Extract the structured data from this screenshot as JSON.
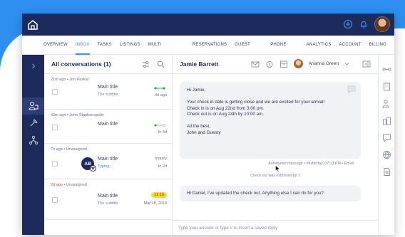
{
  "nav": {
    "items": [
      {
        "label": "OVERVIEW",
        "active": false
      },
      {
        "label": "INBOX",
        "active": true
      },
      {
        "label": "TASKS",
        "active": false
      },
      {
        "label": "LISTINGS",
        "active": false
      },
      {
        "label": "MULTI CALENDAR",
        "active": false
      },
      {
        "label": "RESERVATIONS",
        "active": false
      },
      {
        "label": "GUEST BOOK",
        "active": false
      },
      {
        "label": "PHONE BOOK",
        "active": false
      },
      {
        "label": "ANALYTICS",
        "active": false
      },
      {
        "label": "ACCOUNT",
        "active": false
      },
      {
        "label": "BILLING",
        "active": false
      }
    ]
  },
  "conversations": {
    "title": "All conversations (1)",
    "items": [
      {
        "meta": "21m ago • Jim Paskal",
        "due": "",
        "main": "Main title",
        "sub": "The subtitle",
        "right": "4d ago"
      },
      {
        "meta": "43m ago • John Staphanopolis",
        "due": "",
        "main": "Main title",
        "sub": "",
        "right": "In 4d"
      },
      {
        "meta": "7h ago • Unassigned",
        "due": "",
        "main": "Main title",
        "sub": "Typing...",
        "right_top": "Inquiry",
        "right": "In 2d",
        "avatar": "AB"
      },
      {
        "meta_due": "2d ago",
        "meta": " • Unassigned",
        "main": "Main title",
        "sub": "The subtitle",
        "badge": "12:15",
        "right": "Mar 18, 2018"
      }
    ]
  },
  "chat": {
    "guest_name": "Jamie Barrett",
    "assignee": "Arianna Green",
    "message1": {
      "lines": [
        "Hi Jamie,",
        "",
        "Your check in date is getting close and we are excited for your arrival!",
        "Check in is on Aug 22nd from 3:00 pm.",
        "Check out is on Aug 24th by 10:00 am.",
        "",
        "All the best,",
        "John and Guesty"
      ],
      "meta": "Automated message • Yesterday, 07:13 PM • Email"
    },
    "event": "Check out was extended by 1",
    "message2": {
      "text": "Hi Daniel, I've updated the check out. Anything else I can do for you?"
    },
    "reply_placeholder": "Type your answer or type # to insert a saved reply"
  },
  "colors": {
    "brand_dark": "#1d2a5c",
    "accent": "#3a8ef0",
    "badge": "#ffd43b",
    "status_green": "#2fb344"
  }
}
